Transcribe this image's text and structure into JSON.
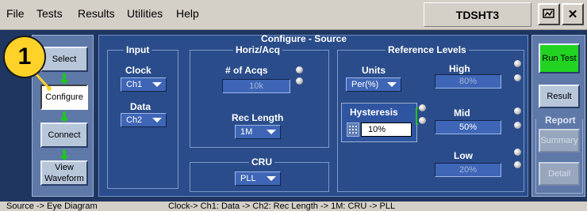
{
  "menu": {
    "items": [
      "File",
      "Tests",
      "Results",
      "Utilities",
      "Help"
    ],
    "product": "TDSHT3"
  },
  "callout": "1",
  "nav": {
    "select": "Select",
    "configure": "Configure",
    "connect": "Connect",
    "view_waveform": "View Waveform"
  },
  "config": {
    "title": "Configure - Source",
    "input": {
      "title": "Input",
      "clock_label": "Clock",
      "clock_value": "Ch1",
      "data_label": "Data",
      "data_value": "Ch2"
    },
    "horiz": {
      "title": "Horiz/Acq",
      "acqs_label": "# of Acqs",
      "acqs_value": "10k",
      "rec_label": "Rec Length",
      "rec_value": "1M"
    },
    "cru": {
      "title": "CRU",
      "value": "PLL"
    },
    "ref": {
      "title": "Reference Levels",
      "units_label": "Units",
      "units_value": "Per(%)",
      "high_label": "High",
      "high_value": "80%",
      "hyst_label": "Hysteresis",
      "hyst_value": "10%",
      "mid_label": "Mid",
      "mid_value": "50%",
      "low_label": "Low",
      "low_value": "20%"
    }
  },
  "right": {
    "run_test": "Run Test",
    "result": "Result",
    "report_title": "Report",
    "summary": "Summary",
    "detail": "Detail"
  },
  "status": {
    "left": "Source -> Eye Diagram",
    "right": "Clock-> Ch1: Data -> Ch2: Rec Length -> 1M: CRU -> PLL"
  },
  "colors": {
    "panel_bg": "#2a4c8a",
    "run_green": "#22d322",
    "callout_yellow": "#ffd22a"
  }
}
